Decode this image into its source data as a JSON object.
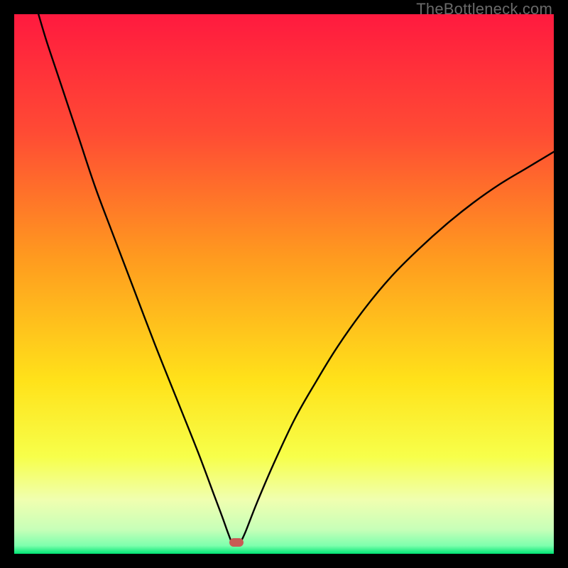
{
  "watermark": "TheBottleneck.com",
  "chart_data": {
    "type": "line",
    "title": "",
    "xlabel": "",
    "ylabel": "",
    "xlim": [
      0,
      100
    ],
    "ylim": [
      0,
      100
    ],
    "gradient_stops": [
      {
        "offset": 0.0,
        "color": "#ff1a3f"
      },
      {
        "offset": 0.22,
        "color": "#ff4b34"
      },
      {
        "offset": 0.45,
        "color": "#ff9a1f"
      },
      {
        "offset": 0.68,
        "color": "#ffe21a"
      },
      {
        "offset": 0.82,
        "color": "#f7ff4a"
      },
      {
        "offset": 0.9,
        "color": "#f0ffb0"
      },
      {
        "offset": 0.955,
        "color": "#c7ffb8"
      },
      {
        "offset": 0.985,
        "color": "#7dffad"
      },
      {
        "offset": 1.0,
        "color": "#00e574"
      }
    ],
    "series": [
      {
        "name": "left-branch",
        "x": [
          4.5,
          6,
          8,
          10,
          12,
          15,
          18,
          22,
          26,
          30,
          34,
          37,
          38.5,
          39.5,
          40.1
        ],
        "y": [
          100,
          95,
          89,
          83,
          77,
          68,
          60,
          49.5,
          39,
          29,
          19,
          11,
          7,
          4.2,
          2.6
        ]
      },
      {
        "name": "right-branch",
        "x": [
          42.2,
          43,
          45,
          48,
          52,
          56,
          60,
          65,
          70,
          75,
          80,
          85,
          90,
          95,
          100
        ],
        "y": [
          2.6,
          4.4,
          9.5,
          16.5,
          25,
          32,
          38.5,
          45.5,
          51.5,
          56.5,
          61,
          65,
          68.5,
          71.5,
          74.5
        ]
      }
    ],
    "marker": {
      "x": 41.2,
      "y": 2.1,
      "color": "#c85a54"
    }
  }
}
